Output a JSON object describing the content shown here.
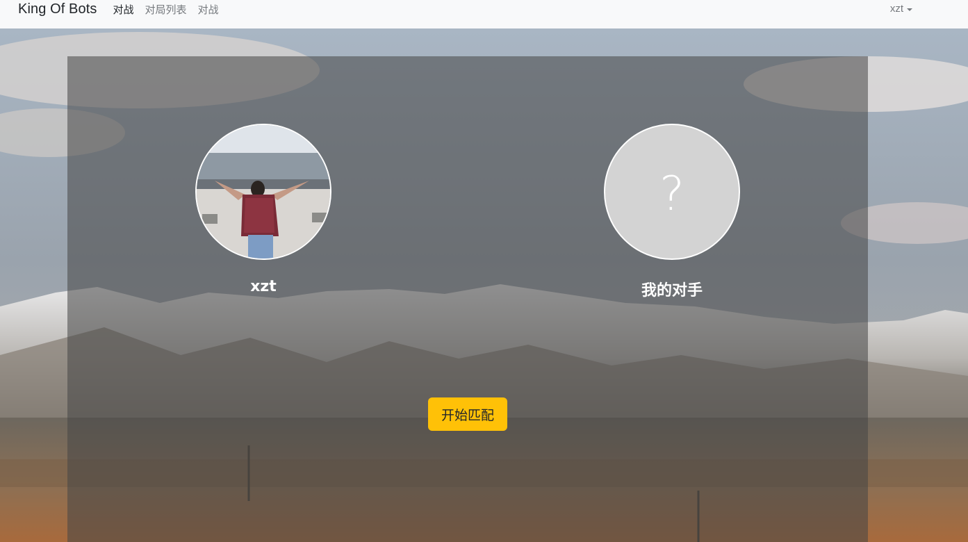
{
  "navbar": {
    "brand": "King Of Bots",
    "links": [
      "对战",
      "对局列表",
      "对战"
    ],
    "user": "xzt"
  },
  "match": {
    "me": {
      "name": "xzt"
    },
    "opponent": {
      "name": "我的对手",
      "placeholder_glyph": "?"
    },
    "start_button": "开始匹配"
  },
  "colors": {
    "navbar_bg": "#f8f9fa",
    "button_bg": "#ffc107",
    "card_overlay": "rgba(70,70,70,0.55)"
  }
}
